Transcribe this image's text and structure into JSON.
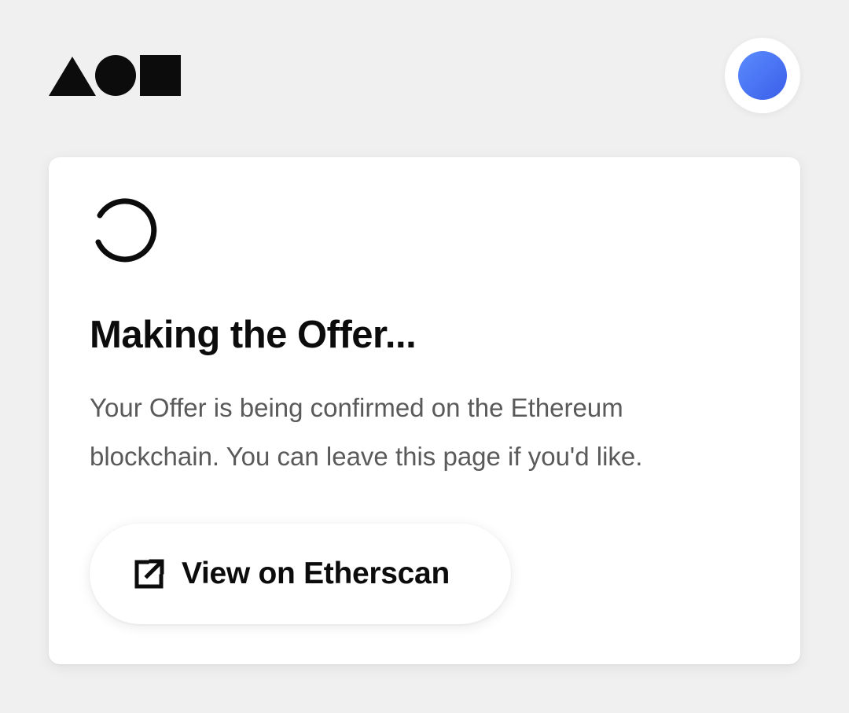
{
  "header": {
    "logo_icon": "triangle-circle-square-logo",
    "avatar_icon": "wallet-avatar-icon",
    "avatar_color": "#3f6ef2"
  },
  "card": {
    "status_icon": "loading-spinner-icon",
    "title": "Making the Offer...",
    "message": "Your Offer is being confirmed on the Ethereum blockchain. You can leave this page if you'd like.",
    "button": {
      "icon": "external-link-icon",
      "label": "View on Etherscan"
    }
  },
  "colors": {
    "background": "#f0f0f0",
    "card": "#ffffff",
    "text_primary": "#0c0c0c",
    "text_secondary": "#5a5a5a",
    "accent_gradient_start": "#5b8cff",
    "accent_gradient_end": "#3a5ee8"
  }
}
